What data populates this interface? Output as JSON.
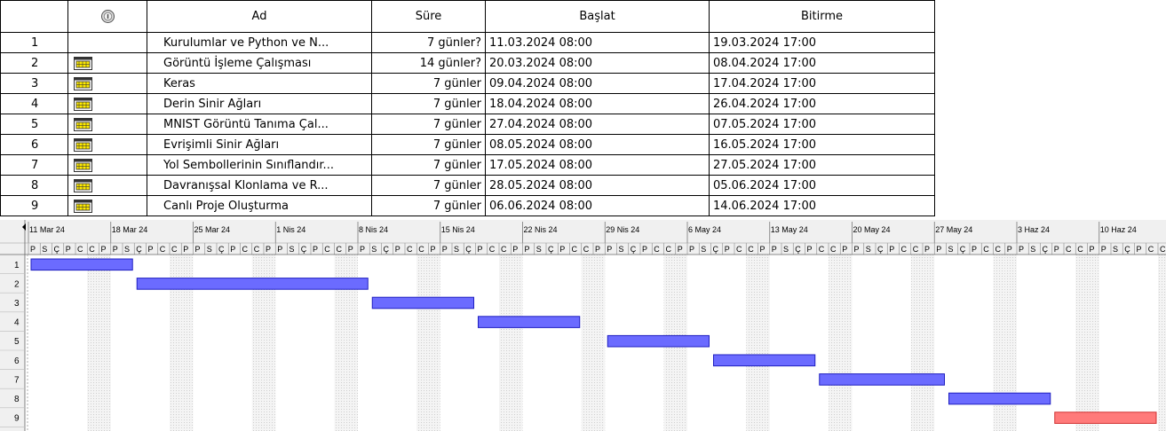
{
  "table": {
    "headers": {
      "indicators": "",
      "name": "Ad",
      "duration": "Süre",
      "start": "Başlat",
      "finish": "Bitirme"
    },
    "rows": [
      {
        "id": "1",
        "name": "Kurulumlar ve Python ve N...",
        "duration": "7 günler?",
        "start": "11.03.2024 08:00",
        "finish": "19.03.2024 17:00",
        "icon": "none"
      },
      {
        "id": "2",
        "name": "Görüntü İşleme Çalışması",
        "duration": "14 günler?",
        "start": "20.03.2024 08:00",
        "finish": "08.04.2024 17:00",
        "icon": "calendar-icon"
      },
      {
        "id": "3",
        "name": "Keras",
        "duration": "7 günler",
        "start": "09.04.2024 08:00",
        "finish": "17.04.2024 17:00",
        "icon": "calendar-icon"
      },
      {
        "id": "4",
        "name": "Derin Sinir Ağları",
        "duration": "7 günler",
        "start": "18.04.2024 08:00",
        "finish": "26.04.2024 17:00",
        "icon": "calendar-icon"
      },
      {
        "id": "5",
        "name": "MNIST Görüntü Tanıma Çal...",
        "duration": "7 günler",
        "start": "27.04.2024 08:00",
        "finish": "07.05.2024 17:00",
        "icon": "calendar-icon"
      },
      {
        "id": "6",
        "name": "Evrişimli Sinir Ağları",
        "duration": "7 günler",
        "start": "08.05.2024 08:00",
        "finish": "16.05.2024 17:00",
        "icon": "calendar-icon"
      },
      {
        "id": "7",
        "name": "Yol Sembollerinin Sınıflandır...",
        "duration": "7 günler",
        "start": "17.05.2024 08:00",
        "finish": "27.05.2024 17:00",
        "icon": "calendar-icon"
      },
      {
        "id": "8",
        "name": "Davranışsal Klonlama ve R...",
        "duration": "7 günler",
        "start": "28.05.2024 08:00",
        "finish": "05.06.2024 17:00",
        "icon": "calendar-icon"
      },
      {
        "id": "9",
        "name": "Canlı Proje Oluşturma",
        "duration": "7 günler",
        "start": "06.06.2024 08:00",
        "finish": "14.06.2024 17:00",
        "icon": "calendar-icon"
      }
    ]
  },
  "chart_data": {
    "type": "gantt",
    "week_labels": [
      "11 Mar 24",
      "18 Mar 24",
      "25 Mar 24",
      "1 Nis 24",
      "8 Nis 24",
      "15 Nis 24",
      "22 Nis 24",
      "29 Nis 24",
      "6 May 24",
      "13 May 24",
      "20 May 24",
      "27 May 24",
      "3 Haz 24",
      "10 Haz 24"
    ],
    "day_letters": [
      "P",
      "S",
      "Ç",
      "P",
      "C",
      "C",
      "P"
    ],
    "tasks": [
      {
        "row": "1",
        "start": "2024-03-11",
        "end": "2024-03-19",
        "color": "#6b6bff",
        "border": "#2020c0"
      },
      {
        "row": "2",
        "start": "2024-03-20",
        "end": "2024-04-08",
        "color": "#6b6bff",
        "border": "#2020c0"
      },
      {
        "row": "3",
        "start": "2024-04-09",
        "end": "2024-04-17",
        "color": "#6b6bff",
        "border": "#2020c0"
      },
      {
        "row": "4",
        "start": "2024-04-18",
        "end": "2024-04-26",
        "color": "#6b6bff",
        "border": "#2020c0"
      },
      {
        "row": "5",
        "start": "2024-04-29",
        "end": "2024-05-07",
        "color": "#6b6bff",
        "border": "#2020c0"
      },
      {
        "row": "6",
        "start": "2024-05-08",
        "end": "2024-05-16",
        "color": "#6b6bff",
        "border": "#2020c0"
      },
      {
        "row": "7",
        "start": "2024-05-17",
        "end": "2024-05-27",
        "color": "#6b6bff",
        "border": "#2020c0"
      },
      {
        "row": "8",
        "start": "2024-05-28",
        "end": "2024-06-05",
        "color": "#6b6bff",
        "border": "#2020c0"
      },
      {
        "row": "9",
        "start": "2024-06-06",
        "end": "2024-06-14",
        "color": "#ff7a7a",
        "border": "#d03030"
      }
    ]
  }
}
